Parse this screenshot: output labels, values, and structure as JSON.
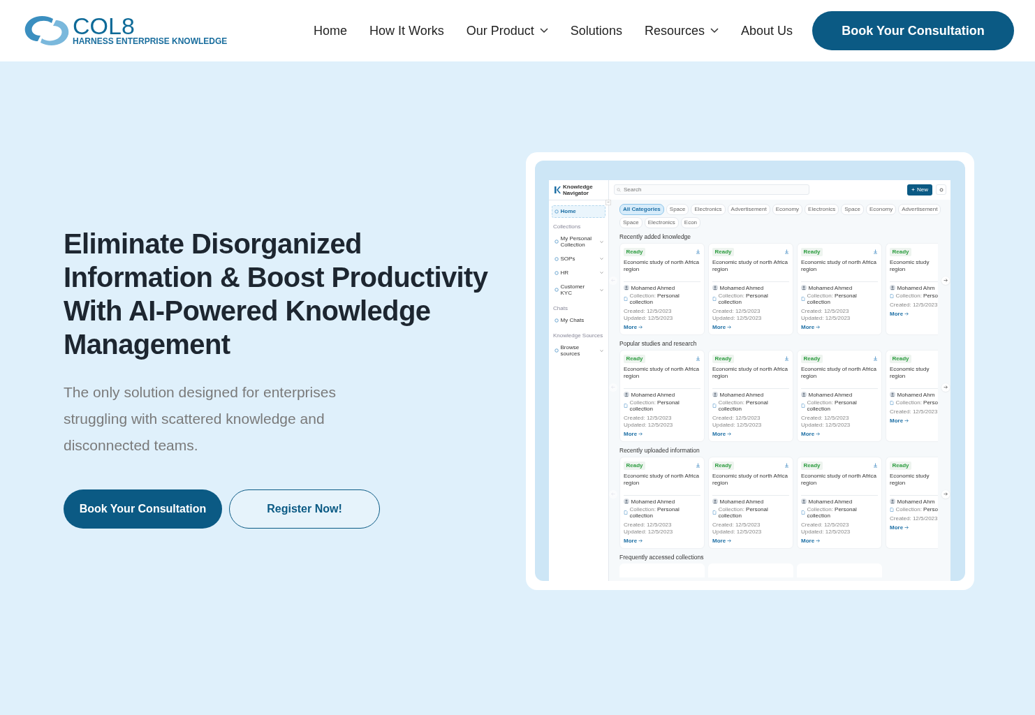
{
  "header": {
    "logo": {
      "name": "COL8",
      "tagline": "HARNESS ENTERPRISE KNOWLEDGE"
    },
    "nav": [
      {
        "label": "Home",
        "dropdown": false
      },
      {
        "label": "How It Works",
        "dropdown": false
      },
      {
        "label": "Our Product",
        "dropdown": true
      },
      {
        "label": "Solutions",
        "dropdown": false
      },
      {
        "label": "Resources",
        "dropdown": true
      },
      {
        "label": "About Us",
        "dropdown": false
      }
    ],
    "cta": "Book Your Consultation"
  },
  "hero": {
    "heading": "Eliminate Disorganized Information & Boost Productivity With AI-Powered Knowledge Management",
    "subtext": "The only solution designed for enterprises struggling with scattered knowledge and disconnected teams.",
    "buttons": [
      {
        "label": "Book Your Consultation",
        "kind": "primary"
      },
      {
        "label": "Register Now!",
        "kind": "outline"
      }
    ]
  },
  "app_preview": {
    "brand": [
      "Knowledge",
      "Navigator"
    ],
    "search_placeholder": "Search",
    "new_button": "New",
    "sidebar": [
      {
        "kind": "item",
        "label": "Home",
        "selected": true,
        "expandable": false
      },
      {
        "kind": "section",
        "label": "Collections"
      },
      {
        "kind": "item",
        "label": "My Personal Collection",
        "selected": false,
        "expandable": true
      },
      {
        "kind": "item",
        "label": "SOPs",
        "selected": false,
        "expandable": true
      },
      {
        "kind": "item",
        "label": "HR",
        "selected": false,
        "expandable": true
      },
      {
        "kind": "item",
        "label": "Customer KYC",
        "selected": false,
        "expandable": true
      },
      {
        "kind": "section",
        "label": "Chats"
      },
      {
        "kind": "item",
        "label": "My Chats",
        "selected": false,
        "expandable": false
      },
      {
        "kind": "section",
        "label": "Knowledge Sources"
      },
      {
        "kind": "item",
        "label": "Browse sources",
        "selected": false,
        "expandable": true
      }
    ],
    "categories": [
      {
        "label": "All Categories",
        "selected": true
      },
      {
        "label": "Space",
        "selected": false
      },
      {
        "label": "Electronics",
        "selected": false
      },
      {
        "label": "Advertisement",
        "selected": false
      },
      {
        "label": "Economy",
        "selected": false
      },
      {
        "label": "Electronics",
        "selected": false
      },
      {
        "label": "Space",
        "selected": false
      },
      {
        "label": "Economy",
        "selected": false
      },
      {
        "label": "Advertisement",
        "selected": false
      },
      {
        "label": "Space",
        "selected": false
      },
      {
        "label": "Electronics",
        "selected": false
      },
      {
        "label": "Econ",
        "selected": false
      }
    ],
    "sections": [
      {
        "title": "Recently added knowledge",
        "cards": [
          {
            "kind": "full",
            "status": "Ready",
            "title_lines": [
              "Economic study of north Africa",
              "region"
            ],
            "author": "Mohamed Ahmed",
            "collection_label": "Collection:",
            "collection": "Personal collection",
            "created": "Created: 12/5/2023",
            "updated": "Updated: 12/5/2023",
            "link": "More"
          },
          {
            "kind": "full",
            "status": "Ready",
            "title_lines": [
              "Economic study of north Africa",
              "region"
            ],
            "author": "Mohamed Ahmed",
            "collection_label": "Collection:",
            "collection": "Personal collection",
            "created": "Created: 12/5/2023",
            "updated": "Updated: 12/5/2023",
            "link": "More"
          },
          {
            "kind": "full",
            "status": "Ready",
            "title_lines": [
              "Economic study of north Africa",
              "region"
            ],
            "author": "Mohamed Ahmed",
            "collection_label": "Collection:",
            "collection": "Personal collection",
            "created": "Created: 12/5/2023",
            "updated": "Updated: 12/5/2023",
            "link": "More"
          },
          {
            "kind": "partial",
            "status": "Ready",
            "title_lines": [
              "Economic study",
              "region"
            ],
            "author": "Mohamed Ahm",
            "collection_label": "Collection:",
            "collection": "Perso",
            "created": "Created: 12/5/2023",
            "link": "More"
          }
        ]
      },
      {
        "title": "Popular studies and research",
        "cards": [
          {
            "kind": "full",
            "status": "Ready",
            "title_lines": [
              "Economic study of north Africa",
              "region"
            ],
            "author": "Mohamed Ahmed",
            "collection_label": "Collection:",
            "collection": "Personal collection",
            "created": "Created: 12/5/2023",
            "updated": "Updated: 12/5/2023",
            "link": "More"
          },
          {
            "kind": "full",
            "status": "Ready",
            "title_lines": [
              "Economic study of north Africa",
              "region"
            ],
            "author": "Mohamed Ahmed",
            "collection_label": "Collection:",
            "collection": "Personal collection",
            "created": "Created: 12/5/2023",
            "updated": "Updated: 12/5/2023",
            "link": "More"
          },
          {
            "kind": "full",
            "status": "Ready",
            "title_lines": [
              "Economic study of north Africa",
              "region"
            ],
            "author": "Mohamed Ahmed",
            "collection_label": "Collection:",
            "collection": "Personal collection",
            "created": "Created: 12/5/2023",
            "updated": "Updated: 12/5/2023",
            "link": "More"
          },
          {
            "kind": "partial",
            "status": "Ready",
            "title_lines": [
              "Economic study",
              "region"
            ],
            "author": "Mohamed Ahm",
            "collection_label": "Collection:",
            "collection": "Perso",
            "created": "Created: 12/5/2023",
            "link": "More"
          }
        ]
      },
      {
        "title": "Recently uploaded information",
        "cards": [
          {
            "kind": "full",
            "status": "Ready",
            "title_lines": [
              "Economic study of north Africa",
              "region"
            ],
            "author": "Mohamed Ahmed",
            "collection_label": "Collection:",
            "collection": "Personal collection",
            "created": "Created: 12/5/2023",
            "updated": "Updated: 12/5/2023",
            "link": "More"
          },
          {
            "kind": "full",
            "status": "Ready",
            "title_lines": [
              "Economic study of north Africa",
              "region"
            ],
            "author": "Mohamed Ahmed",
            "collection_label": "Collection:",
            "collection": "Personal collection",
            "created": "Created: 12/5/2023",
            "updated": "Updated: 12/5/2023",
            "link": "More"
          },
          {
            "kind": "full",
            "status": "Ready",
            "title_lines": [
              "Economic study of north Africa",
              "region"
            ],
            "author": "Mohamed Ahmed",
            "collection_label": "Collection:",
            "collection": "Personal collection",
            "created": "Created: 12/5/2023",
            "updated": "Updated: 12/5/2023",
            "link": "More"
          },
          {
            "kind": "partial",
            "status": "Ready",
            "title_lines": [
              "Economic study",
              "region"
            ],
            "author": "Mohamed Ahm",
            "collection_label": "Collection:",
            "collection": "Perso",
            "created": "Created: 12/5/2023",
            "link": "More"
          }
        ]
      },
      {
        "title": "Frequently accessed collections"
      }
    ]
  }
}
